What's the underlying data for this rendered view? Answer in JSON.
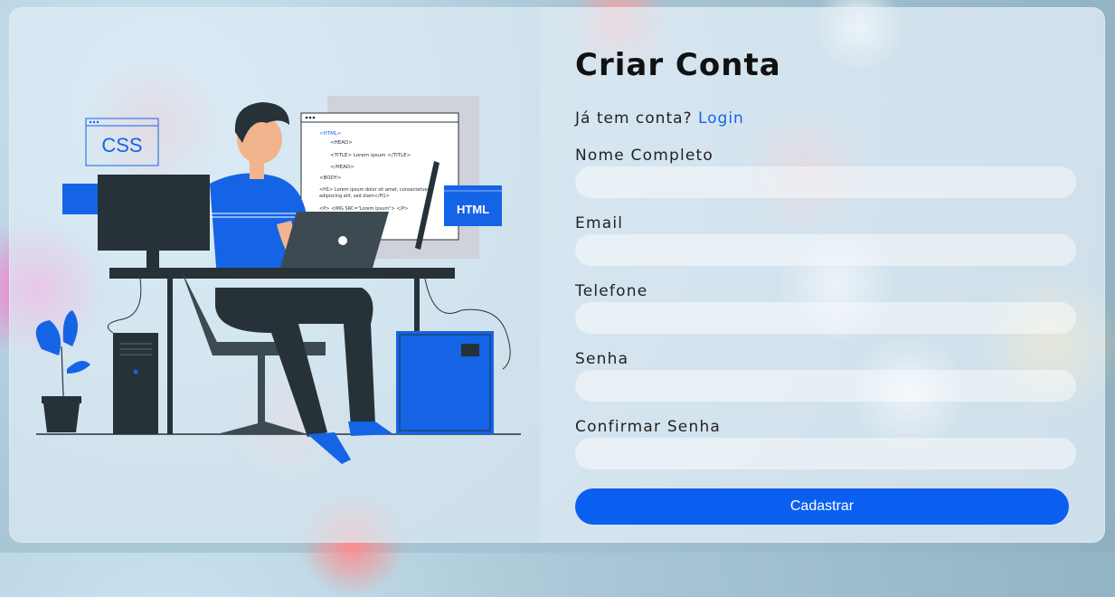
{
  "form": {
    "title": "Criar Conta",
    "have_account_text": "Já tem conta?",
    "login_link": "Login",
    "fields": [
      {
        "label": "Nome Completo",
        "value": "",
        "placeholder": ""
      },
      {
        "label": "Email",
        "value": "",
        "placeholder": ""
      },
      {
        "label": "Telefone",
        "value": "",
        "placeholder": ""
      },
      {
        "label": "Senha",
        "value": "",
        "placeholder": ""
      },
      {
        "label": "Confirmar Senha",
        "value": "",
        "placeholder": ""
      }
    ],
    "submit_label": "Cadastrar"
  },
  "illustration": {
    "css_badge": "CSS",
    "html_badge": "HTML",
    "code_lines": [
      "<HTML>",
      "<HEAD>",
      "<TITLE> Lorem ipsum </TITLE>",
      "</HEAD>",
      "<BODY>",
      "<H1> Lorem ipsum dolor sit amet, consectetuer",
      "adipiscing elit, sed diam</H1>",
      "<P> <IMG SRC=\"Lorem ipsum\"> </P>"
    ]
  },
  "colors": {
    "accent": "#0a5ff0",
    "link": "#1564e6",
    "dark": "#263238"
  }
}
